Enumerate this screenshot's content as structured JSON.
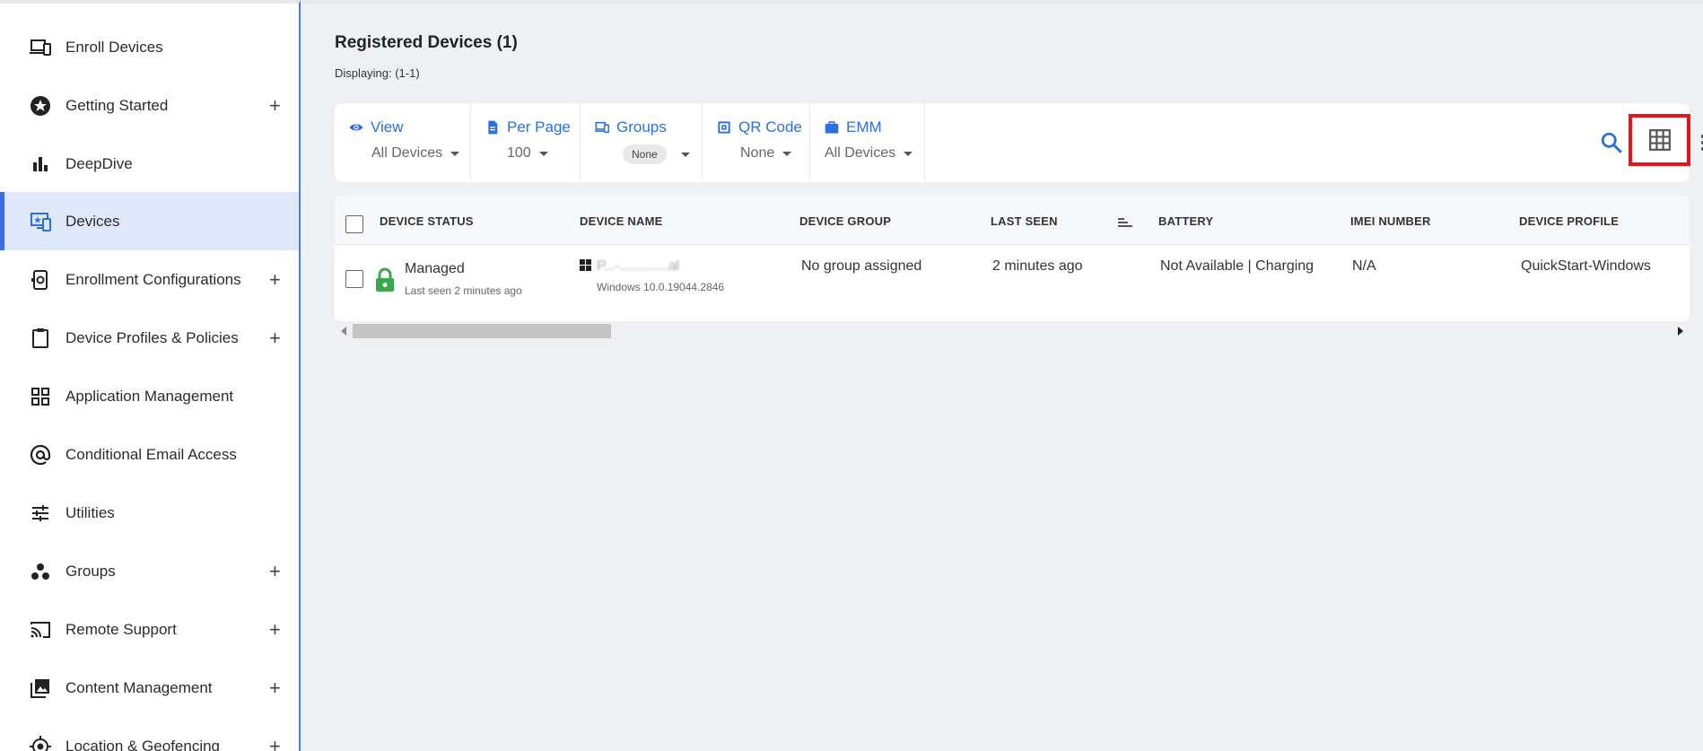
{
  "sidebar": {
    "items": [
      {
        "label": "Enroll Devices",
        "icon": "devices-icon",
        "expandable": false,
        "active": false
      },
      {
        "label": "Getting Started",
        "icon": "star-badge-icon",
        "expandable": true,
        "active": false
      },
      {
        "label": "DeepDive",
        "icon": "bar-chart-icon",
        "expandable": false,
        "active": false
      },
      {
        "label": "Devices",
        "icon": "device-monitor-icon",
        "expandable": false,
        "active": true
      },
      {
        "label": "Enrollment Configurations",
        "icon": "phone-gear-icon",
        "expandable": true,
        "active": false
      },
      {
        "label": "Device Profiles & Policies",
        "icon": "clipboard-icon",
        "expandable": true,
        "active": false
      },
      {
        "label": "Application Management",
        "icon": "apps-grid-icon",
        "expandable": false,
        "active": false
      },
      {
        "label": "Conditional Email Access",
        "icon": "at-sign-icon",
        "expandable": false,
        "active": false
      },
      {
        "label": "Utilities",
        "icon": "sliders-icon",
        "expandable": false,
        "active": false
      },
      {
        "label": "Groups",
        "icon": "groups-icon",
        "expandable": true,
        "active": false
      },
      {
        "label": "Remote Support",
        "icon": "cast-icon",
        "expandable": true,
        "active": false
      },
      {
        "label": "Content Management",
        "icon": "photo-library-icon",
        "expandable": true,
        "active": false
      },
      {
        "label": "Location & Geofencing",
        "icon": "location-target-icon",
        "expandable": true,
        "active": false
      }
    ],
    "plus_symbol": "+"
  },
  "main": {
    "title": "Registered Devices (1)",
    "subtitle": "Displaying: (1-1)"
  },
  "toolbar": {
    "view": {
      "label": "View",
      "value": "All Devices"
    },
    "per_page": {
      "label": "Per Page",
      "value": "100"
    },
    "groups": {
      "label": "Groups",
      "value": "None"
    },
    "qr_code": {
      "label": "QR Code",
      "value": "None"
    },
    "emm": {
      "label": "EMM",
      "value": "All Devices"
    }
  },
  "table": {
    "columns": [
      "DEVICE STATUS",
      "DEVICE NAME",
      "DEVICE GROUP",
      "LAST SEEN",
      "BATTERY",
      "IMEI NUMBER",
      "DEVICE PROFILE"
    ],
    "rows": [
      {
        "status": "Managed",
        "status_sub": "Last seen 2 minutes ago",
        "device_name": "P...-..............al",
        "device_os": "Windows 10.0.19044.2846",
        "device_group": "No group assigned",
        "last_seen": "2 minutes ago",
        "battery": "Not Available | Charging",
        "imei": "N/A",
        "profile": "QuickStart-Windows"
      }
    ]
  },
  "colors": {
    "accent": "#2d6fe0",
    "active_bg": "#dfe8fb",
    "highlight_box": "#e5141b",
    "managed_lock": "#3aa84b"
  }
}
